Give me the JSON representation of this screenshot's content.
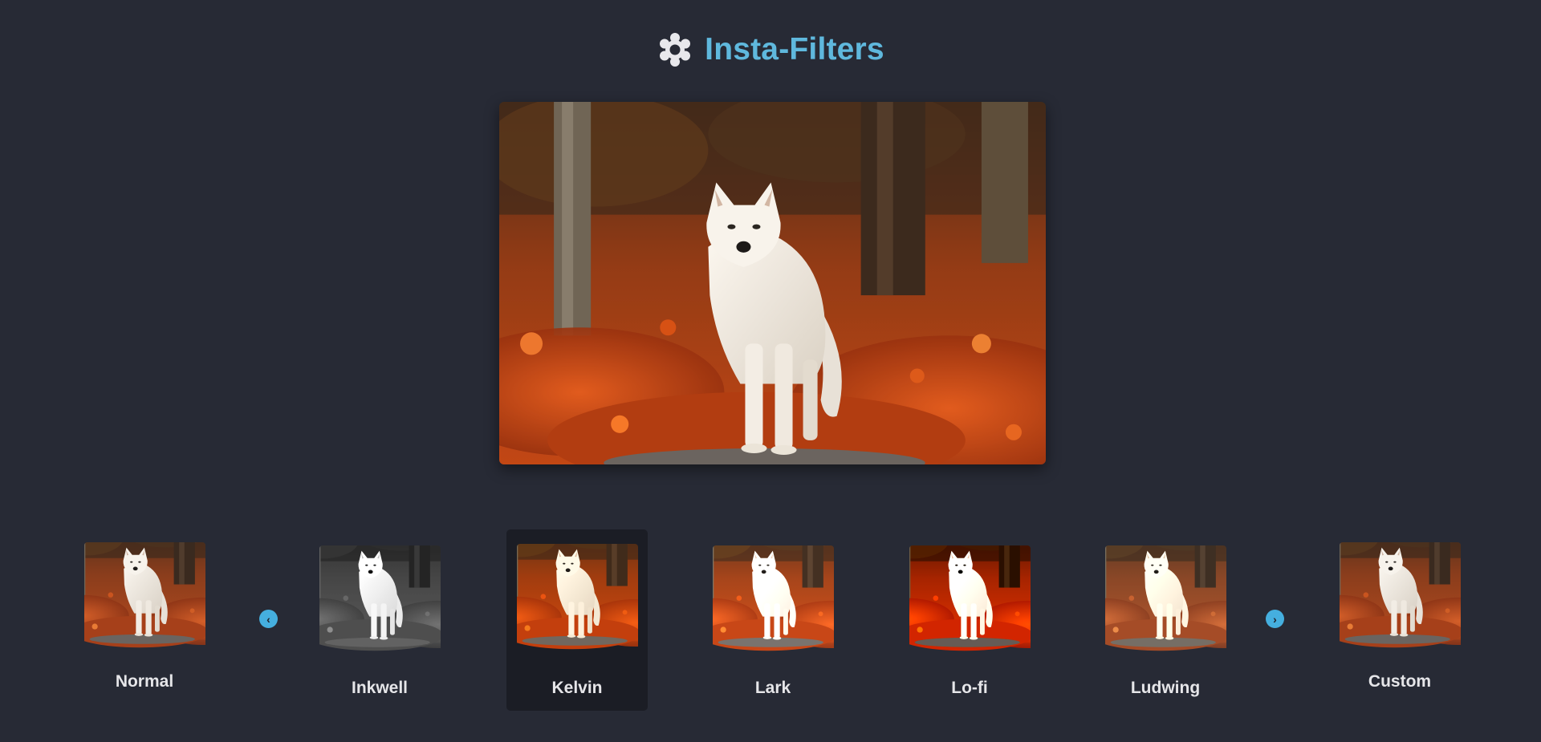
{
  "app": {
    "title": "Insta-Filters",
    "logo_icon": "gear-flower-icon"
  },
  "colors": {
    "background": "#272a35",
    "accent": "#5fb8dd",
    "selected_card": "#1b1d25",
    "label": "#e6e6e9"
  },
  "main_image": {
    "subject": "white wolf standing on autumn leaves",
    "active_filter": "Kelvin"
  },
  "filters": [
    {
      "label": "Normal",
      "css_filter": "none",
      "selected": false
    },
    {
      "label": "Inkwell",
      "css_filter": "grayscale(1) contrast(1.1)",
      "selected": false
    },
    {
      "label": "Kelvin",
      "css_filter": "saturate(1.5) sepia(0.15)",
      "selected": true
    },
    {
      "label": "Lark",
      "css_filter": "brightness(1.15) saturate(1.1)",
      "selected": false
    },
    {
      "label": "Lo-fi",
      "css_filter": "contrast(1.3) saturate(1.3)",
      "selected": false
    },
    {
      "label": "Ludwing",
      "css_filter": "sepia(0.2) brightness(1.05)",
      "selected": false
    },
    {
      "label": "Custom",
      "css_filter": "none",
      "selected": false
    }
  ],
  "navigation": {
    "prev_icon": "chevron-left-icon",
    "next_icon": "chevron-right-icon",
    "prev_glyph": "‹",
    "next_glyph": "›"
  }
}
